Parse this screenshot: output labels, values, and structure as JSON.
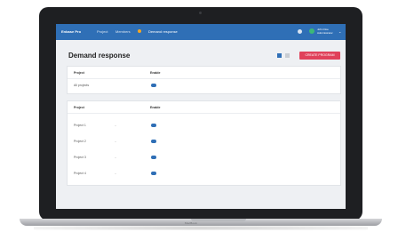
{
  "app": {
    "logo": "Enbase Pro",
    "nav": [
      "Project",
      "Members",
      "Demand response"
    ]
  },
  "user": {
    "name": "John Doe",
    "role": "Administrator"
  },
  "page": {
    "title": "Demand response",
    "create_label": "CREATE PROGRAM"
  },
  "overview_table": {
    "headers": [
      "Project",
      "Enable"
    ],
    "rows": [
      {
        "project": "All projects",
        "enabled": true
      }
    ]
  },
  "projects_table": {
    "headers": [
      "Project",
      "Enable"
    ],
    "rows": [
      {
        "project": "Project 1",
        "detail": "–",
        "enabled": true
      },
      {
        "project": "Project 2",
        "detail": "–",
        "enabled": true
      },
      {
        "project": "Project 3",
        "detail": "–",
        "enabled": true
      },
      {
        "project": "Project 4",
        "detail": "–",
        "enabled": true
      }
    ]
  },
  "device": {
    "brand": "MacBook"
  },
  "colors": {
    "accent": "#2f6fb6",
    "create": "#e0415a",
    "badge": "#f4a623"
  }
}
